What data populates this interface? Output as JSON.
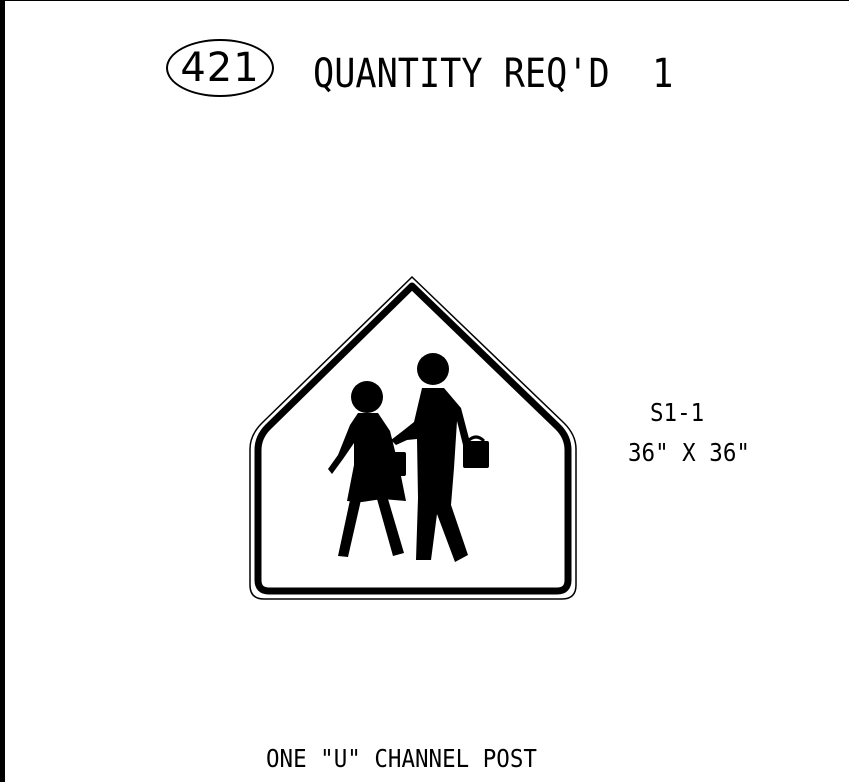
{
  "sign_number": "421",
  "header": {
    "quantity_label": "QUANTITY REQ'D",
    "quantity_value": "1"
  },
  "sign": {
    "code": "S1-1",
    "size": "36\" X 36\"",
    "symbol": "school-crossing-pedestrians-icon"
  },
  "post_note": "ONE \"U\" CHANNEL POST"
}
